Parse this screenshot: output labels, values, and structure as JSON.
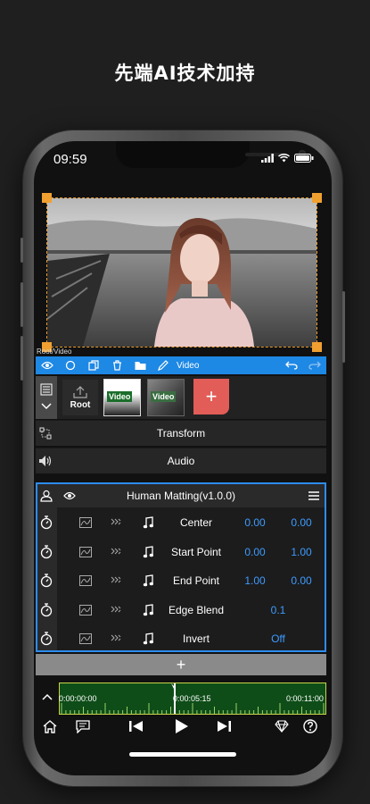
{
  "headline": "先端AI技术加持",
  "status_bar": {
    "time": "09:59"
  },
  "breadcrumb": "Root/Video",
  "toolbar": {
    "clip_label": "Video"
  },
  "layers": {
    "root_label": "Root",
    "clips": [
      {
        "label": "Video"
      },
      {
        "label": "Video"
      }
    ],
    "add_symbol": "+"
  },
  "sections": {
    "transform": "Transform",
    "audio": "Audio"
  },
  "effect": {
    "title": "Human Matting(v1.0.0)",
    "params": [
      {
        "name": "Center",
        "v1": "0.00",
        "v2": "0.00"
      },
      {
        "name": "Start Point",
        "v1": "0.00",
        "v2": "1.00"
      },
      {
        "name": "End Point",
        "v1": "1.00",
        "v2": "0.00"
      },
      {
        "name": "Edge Blend",
        "v": "0.1"
      },
      {
        "name": "Invert",
        "v": "Off"
      }
    ]
  },
  "add_effect_symbol": "+",
  "timeline": {
    "start": "0:00:00:00",
    "mid": "0:00:05:15",
    "end": "0:00:11:00"
  },
  "colors": {
    "accent": "#1e88e5",
    "handle": "#f0a030",
    "timeline": "#0e4d18",
    "add": "#e25c58"
  }
}
